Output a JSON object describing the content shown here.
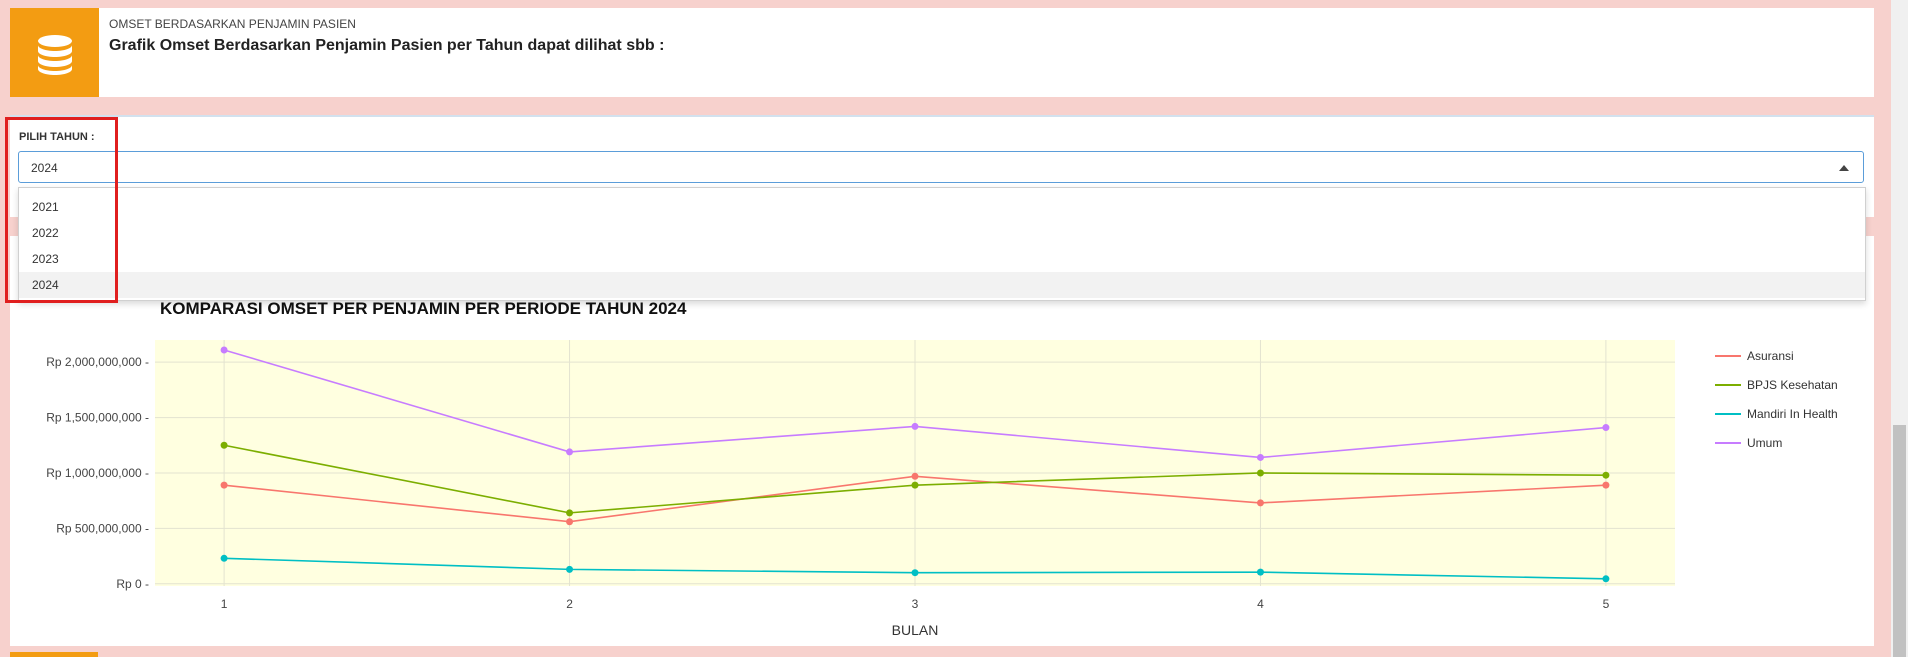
{
  "header": {
    "subtitle": "OMSET BERDASARKAN PENJAMIN PASIEN",
    "title": "Grafik Omset Berdasarkan Penjamin Pasien per Tahun dapat dilihat sbb :",
    "icon": "coins-icon",
    "icon_bg": "#f39c12"
  },
  "filter": {
    "label": "PILIH TAHUN :",
    "value": "2024",
    "options": [
      "2021",
      "2022",
      "2023",
      "2024"
    ],
    "active_option": "2024"
  },
  "chart_data": {
    "type": "line",
    "title": "KOMPARASI OMSET PER PENJAMIN PER PERIODE TAHUN 2024",
    "xlabel": "BULAN",
    "ylabel": "",
    "x": [
      1,
      2,
      3,
      4,
      5
    ],
    "x_ticks": [
      "1",
      "2",
      "3",
      "4",
      "5"
    ],
    "y_ticks": [
      {
        "value": 0,
        "label": "Rp 0"
      },
      {
        "value": 500000000,
        "label": "Rp 500,000,000"
      },
      {
        "value": 1000000000,
        "label": "Rp 1,000,000,000"
      },
      {
        "value": 1500000000,
        "label": "Rp 1,500,000,000"
      },
      {
        "value": 2000000000,
        "label": "Rp 2,000,000,000"
      }
    ],
    "ylim": [
      -20000000,
      2200000000
    ],
    "xlim": [
      0.8,
      5.2
    ],
    "plot_bg": "#ffffe0",
    "grid": true,
    "legend": "right",
    "series": [
      {
        "name": "Asuransi",
        "color": "#f8766d",
        "values": [
          890000000,
          560000000,
          970000000,
          730000000,
          890000000
        ]
      },
      {
        "name": "BPJS Kesehatan",
        "color": "#7cae00",
        "values": [
          1250000000,
          640000000,
          890000000,
          1000000000,
          980000000
        ]
      },
      {
        "name": "Mandiri In Health",
        "color": "#00bfc4",
        "values": [
          230000000,
          130000000,
          100000000,
          105000000,
          45000000
        ]
      },
      {
        "name": "Umum",
        "color": "#c77cff",
        "values": [
          2110000000,
          1190000000,
          1420000000,
          1140000000,
          1410000000
        ]
      }
    ]
  }
}
